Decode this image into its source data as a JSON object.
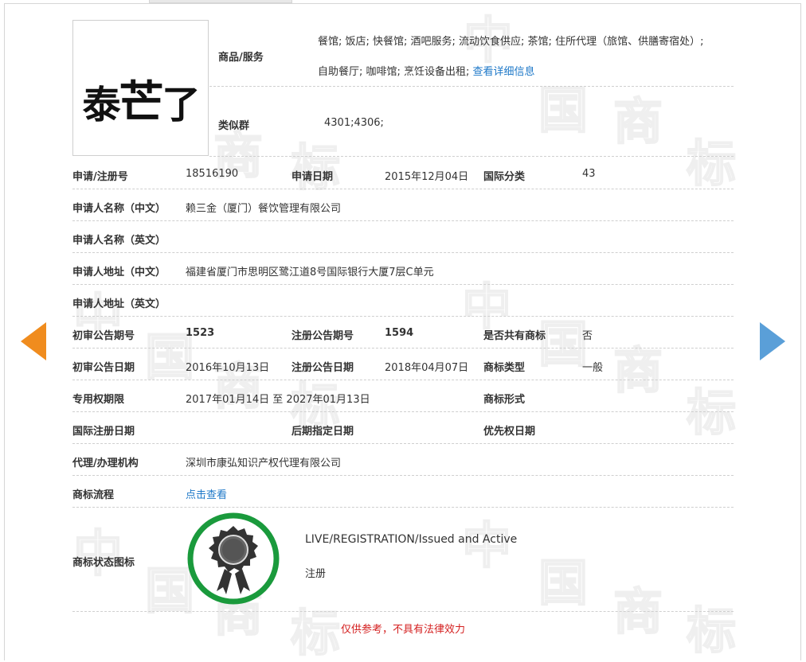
{
  "watermark": {
    "chars": [
      "中",
      "国",
      "商",
      "标"
    ]
  },
  "logo": {
    "text_small_1": "泰",
    "text_big": "芒",
    "text_small_2": "了"
  },
  "goods": {
    "label": "商品/服务",
    "line1": "餐馆; 饭店; 快餐馆; 酒吧服务; 流动饮食供应; 茶馆; 住所代理（旅馆、供膳寄宿处）;",
    "line2": "自助餐厅; 咖啡馆; 烹饪设备出租;",
    "detail_link": "查看详细信息"
  },
  "similar": {
    "label": "类似群",
    "value": "4301;4306;"
  },
  "rows": {
    "reg_no": {
      "label": "申请/注册号",
      "value": "18516190"
    },
    "apply_date": {
      "label": "申请日期",
      "value": "2015年12月04日"
    },
    "intl_class": {
      "label": "国际分类",
      "value": "43"
    },
    "applicant_cn": {
      "label": "申请人名称（中文）",
      "value": "赖三金（厦门）餐饮管理有限公司"
    },
    "applicant_en": {
      "label": "申请人名称（英文）",
      "value": ""
    },
    "address_cn": {
      "label": "申请人地址（中文）",
      "value": "福建省厦门市思明区鹭江道8号国际银行大厦7层C单元"
    },
    "address_en": {
      "label": "申请人地址（英文）",
      "value": ""
    },
    "prelim_issue": {
      "label": "初审公告期号",
      "value": "1523"
    },
    "reg_issue": {
      "label": "注册公告期号",
      "value": "1594"
    },
    "shared": {
      "label": "是否共有商标",
      "value": "否"
    },
    "prelim_date": {
      "label": "初审公告日期",
      "value": "2016年10月13日"
    },
    "reg_date": {
      "label": "注册公告日期",
      "value": "2018年04月07日"
    },
    "tm_type": {
      "label": "商标类型",
      "value": "一般"
    },
    "term": {
      "label": "专用权期限",
      "value": "2017年01月14日 至 2027年01月13日"
    },
    "tm_form": {
      "label": "商标形式",
      "value": ""
    },
    "intl_reg_date": {
      "label": "国际注册日期",
      "value": ""
    },
    "later_date": {
      "label": "后期指定日期",
      "value": ""
    },
    "priority_date": {
      "label": "优先权日期",
      "value": ""
    },
    "agent": {
      "label": "代理/办理机构",
      "value": "深圳市康弘知识产权代理有限公司"
    },
    "process": {
      "label": "商标流程",
      "link": "点击查看"
    },
    "status": {
      "label": "商标状态图标",
      "status_en": "LIVE/REGISTRATION/Issued and Active",
      "status_cn": "注册"
    }
  },
  "disclaimer": "仅供参考，不具有法律效力",
  "colors": {
    "link": "#1e78c8",
    "disclaimer": "#d42020",
    "badge_ring": "#1a9a3c",
    "prev_arrow": "#f08c1e",
    "next_arrow": "#5a9fd8"
  },
  "icons": {
    "prev": "arrow-left-icon",
    "next": "arrow-right-icon",
    "status_badge": "ribbon-seal-icon"
  }
}
